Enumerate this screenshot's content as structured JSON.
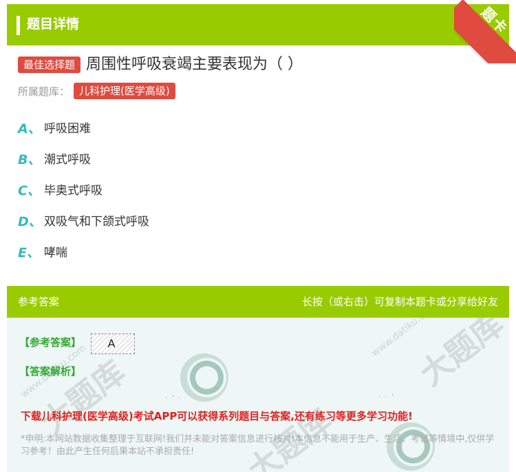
{
  "header": {
    "title": "题目详情",
    "ribbon_label": "题卡"
  },
  "question": {
    "type_tag": "最佳选择题",
    "text": "周围性呼吸衰竭主要表现为（ ）",
    "bank_label": "所属题库：",
    "bank_name": "儿科护理(医学高级)"
  },
  "options": [
    {
      "letter": "A、",
      "text": "呼吸困难"
    },
    {
      "letter": "B、",
      "text": "潮式呼吸"
    },
    {
      "letter": "C、",
      "text": "毕奥式呼吸"
    },
    {
      "letter": "D、",
      "text": "双吸气和下颌式呼吸"
    },
    {
      "letter": "E、",
      "text": "哮喘"
    }
  ],
  "answer_section": {
    "title": "参考答案",
    "hint": "长按（或右击）可复制本题卡或分享给好友",
    "answer_label": "【参考答案】",
    "answer_value": "A",
    "explain_label": "【答案解析】",
    "promo": "下载儿科护理(医学高级)考试APP可以获得系列题目与答案,还有练习等更多学习功能!",
    "disclaimer": "*申明:本网站数据收集整理于互联网!我们并未能对答案信息进行核对!本信息不能用于生产、生活、考试等情境中,仅供学习参考！由此产生任何后果本站不承担责任!"
  },
  "watermark": {
    "text": "大题库",
    "domain": "www.datiku.com"
  },
  "colors": {
    "brand_green": "#99cc00",
    "tag_red": "#e04a3f",
    "option_teal": "#33bbbb",
    "answer_green": "#33aa33",
    "promo_red": "#e02020"
  }
}
